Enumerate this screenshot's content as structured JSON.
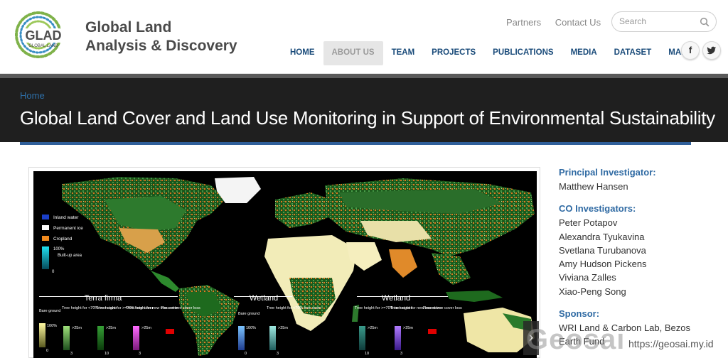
{
  "brand": {
    "logo_text": "GLAD",
    "logo_subtext": "GLOBAL LAND",
    "line1": "Global Land",
    "line2": "Analysis & Discovery"
  },
  "top_links": [
    "Partners",
    "Contact Us"
  ],
  "search": {
    "placeholder": "Search"
  },
  "nav": {
    "items": [
      "HOME",
      "ABOUT US",
      "TEAM",
      "PROJECTS",
      "PUBLICATIONS",
      "MEDIA",
      "DATASET",
      "MAPS"
    ],
    "active": "ABOUT US"
  },
  "social": {
    "facebook": "f",
    "twitter_icon": "bird-icon"
  },
  "breadcrumb": "Home",
  "page_title": "Global Land Cover and Land Use Monitoring in Support of Environmental Sustainability",
  "map_legend": {
    "top_items": [
      {
        "label": "Inland water",
        "color": "#1a3fc8"
      },
      {
        "label": "Permanent ice",
        "color": "#ffffff"
      },
      {
        "label": "Cropland",
        "color": "#f08a1e"
      }
    ],
    "builtup": {
      "max": "100%",
      "label": "Built-up area",
      "min": "0"
    },
    "terra_firma": {
      "title": "Terra firma",
      "scales": [
        {
          "label": "Bare ground",
          "max": "100%",
          "min": "0"
        },
        {
          "label": "Tree height for <70% tree cover",
          "max": ">25m",
          "min": "3"
        },
        {
          "label": "Tree height for >=70% tree cover",
          "max": ">25m",
          "min": "10"
        },
        {
          "label": "Tree height for new tree cover",
          "max": ">25m",
          "min": "3"
        },
        {
          "label": "Recent tree cover loss",
          "max": "",
          "min": ""
        }
      ]
    },
    "wetland_1": {
      "title": "Wetland",
      "scales": [
        {
          "label": "Bare ground",
          "max": "100%",
          "min": "0"
        },
        {
          "label": "Tree height for <70% tree cover",
          "max": ">25m",
          "min": "3"
        }
      ]
    },
    "wetland_2": {
      "title": "Wetland",
      "scales": [
        {
          "label": "Tree height for >=70% tree cover",
          "max": ">25m",
          "min": "10"
        },
        {
          "label": "Tree height for new tree cover",
          "max": ">25m",
          "min": "3"
        },
        {
          "label": "Recent tree cover loss",
          "max": "",
          "min": ""
        }
      ]
    }
  },
  "sidebar": {
    "pi_heading": "Principal Investigator:",
    "pi": "Matthew Hansen",
    "co_heading": "CO Investigators:",
    "co": [
      "Peter Potapov",
      "Alexandra Tyukavina",
      "Svetlana Turubanova",
      "Amy Hudson Pickens",
      "Viviana Zalles",
      "Xiao-Peng Song"
    ],
    "sponsor_heading": "Sponsor:",
    "sponsor": [
      "WRI Land & Carbon Lab, Bezos",
      "Earth Fund"
    ]
  },
  "watermark": {
    "text": "Geosai",
    "url": "https://geosai.my.id"
  },
  "colors": {
    "nav_text": "#1a4b7a",
    "heading_blue": "#2f6aa3",
    "banner_bg": "#1f1f1f",
    "accent_rule": "#2f5f9a"
  }
}
